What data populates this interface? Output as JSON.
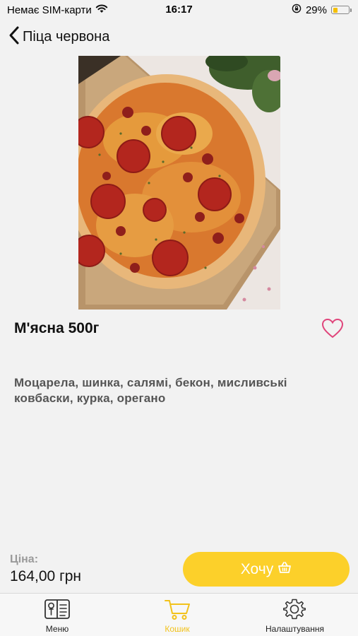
{
  "status_bar": {
    "carrier": "Немає SIM-карти",
    "time": "16:17",
    "battery": "29%",
    "battery_level": 0.29
  },
  "nav": {
    "title": "Піца червона"
  },
  "product": {
    "name": "М'ясна 500г",
    "description": "Моцарела, шинка, салямі, бекон, мисливські ковбаски, курка, орегано",
    "favorite": false
  },
  "price": {
    "label": "Ціна:",
    "value": "164,00 грн"
  },
  "actions": {
    "want_label": "Хочу"
  },
  "tabs": [
    {
      "label": "Меню",
      "icon": "menu-book-icon",
      "active": false
    },
    {
      "label": "Кошик",
      "icon": "cart-icon",
      "active": true
    },
    {
      "label": "Налаштування",
      "icon": "gear-icon",
      "active": false
    }
  ],
  "colors": {
    "accent": "#fcd02a",
    "active_tab": "#f2c21b",
    "favorite": "#e0457b",
    "background": "#f2f2f2"
  }
}
